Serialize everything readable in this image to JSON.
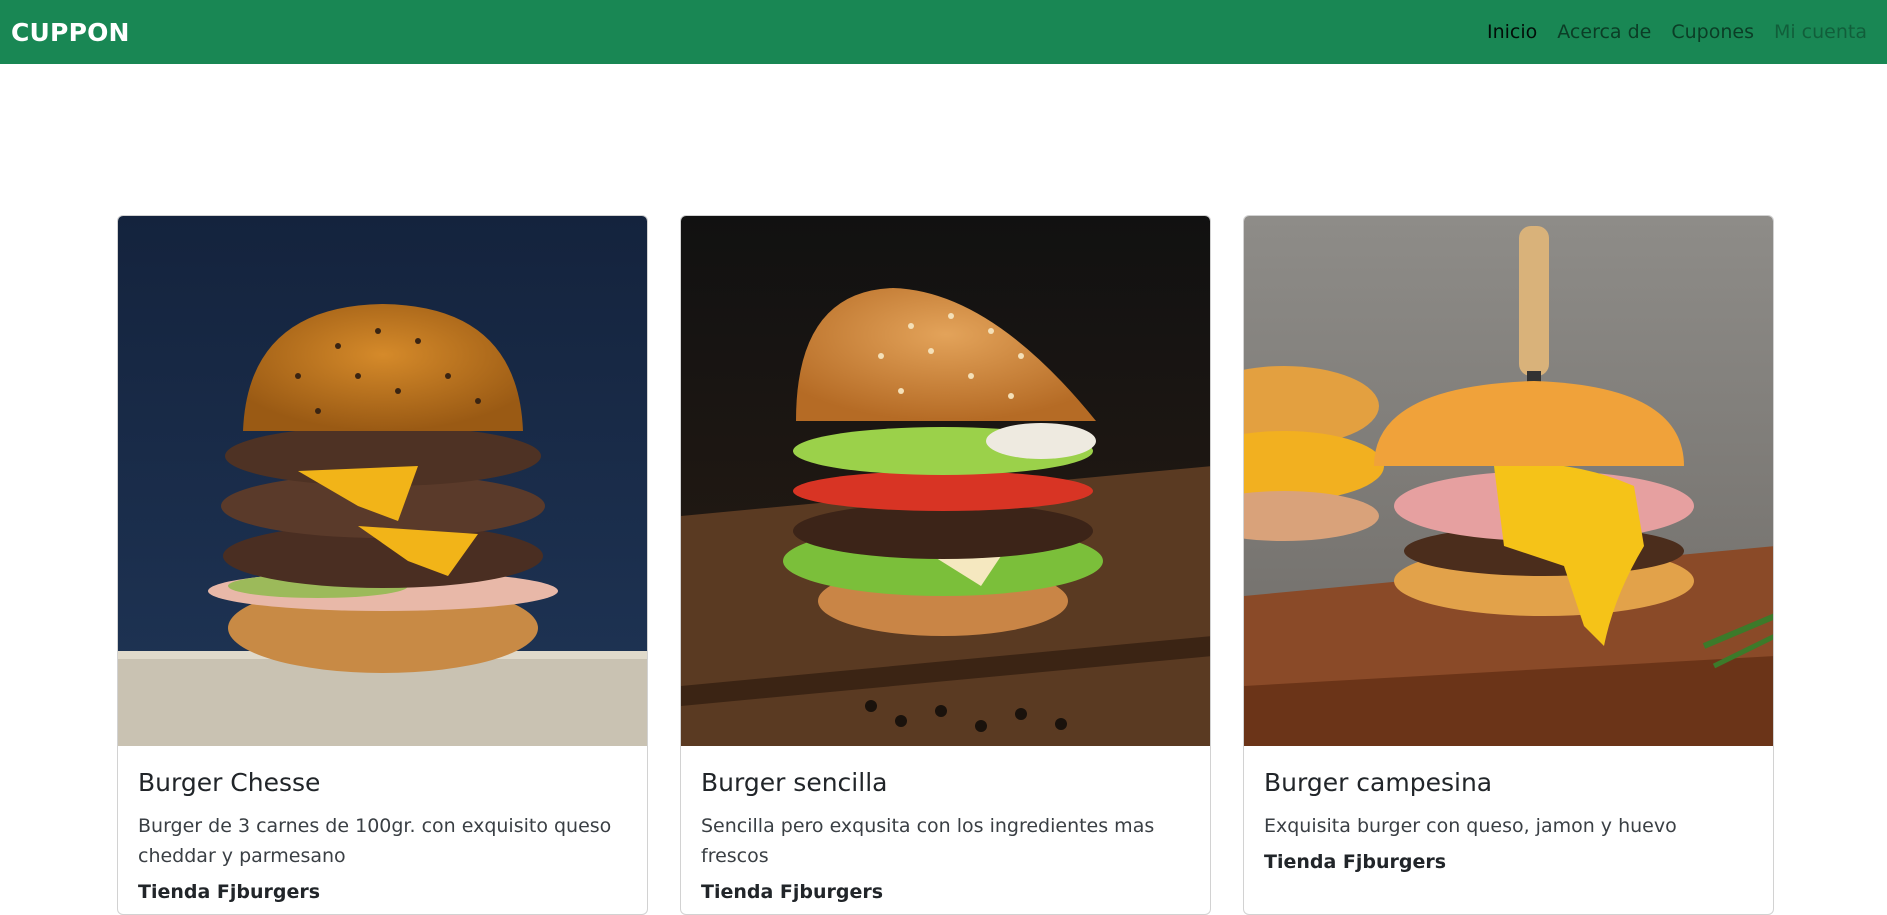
{
  "navbar": {
    "brand": "CUPPON",
    "links": [
      {
        "label": "Inicio",
        "state": "active"
      },
      {
        "label": "Acerca de",
        "state": "normal"
      },
      {
        "label": "Cupones",
        "state": "normal"
      },
      {
        "label": "Mi cuenta",
        "state": "disabled"
      }
    ]
  },
  "colors": {
    "navbar_bg": "#198754",
    "brand_text": "#ffffff"
  },
  "cards": [
    {
      "title": "Burger Chesse",
      "description": "Burger de 3 carnes de 100gr. con exquisito queso cheddar y parmesano",
      "store": "Tienda Fjburgers",
      "image_icon": "burger-cheese-photo"
    },
    {
      "title": "Burger sencilla",
      "description": "Sencilla pero exqusita con los ingredientes mas frescos",
      "store": "Tienda Fjburgers",
      "image_icon": "burger-simple-photo"
    },
    {
      "title": "Burger campesina",
      "description": "Exquisita burger con queso, jamon y huevo",
      "store": "Tienda Fjburgers",
      "image_icon": "burger-campesina-photo"
    }
  ]
}
